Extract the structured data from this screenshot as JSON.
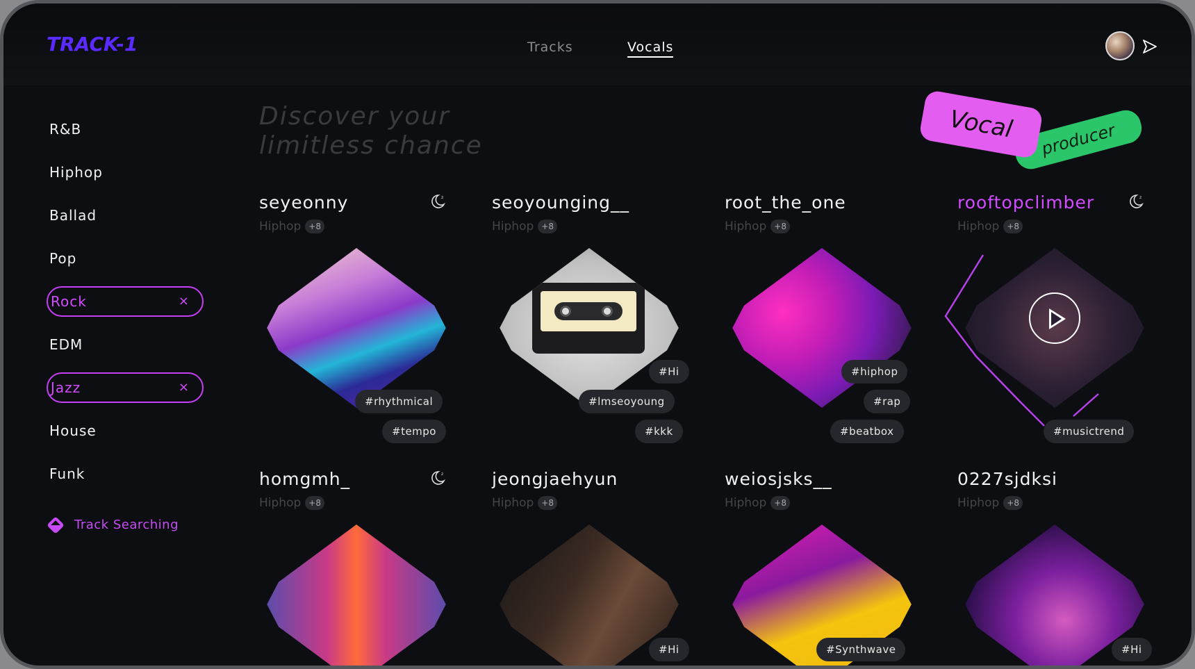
{
  "brand": {
    "logo_text": "TRACK-1",
    "accent": "#5a2bff"
  },
  "nav": {
    "tracks": "Tracks",
    "vocals": "Vocals",
    "active": "Vocals"
  },
  "sidebar": {
    "genres": [
      {
        "label": "R&B",
        "selected": false
      },
      {
        "label": "Hiphop",
        "selected": false
      },
      {
        "label": "Ballad",
        "selected": false
      },
      {
        "label": "Pop",
        "selected": false
      },
      {
        "label": "Rock",
        "selected": true
      },
      {
        "label": "EDM",
        "selected": false
      },
      {
        "label": "Jazz",
        "selected": true
      },
      {
        "label": "House",
        "selected": false
      },
      {
        "label": "Funk",
        "selected": false
      }
    ],
    "remove_glyph": "×",
    "track_search": "Track Searching"
  },
  "hero": {
    "headline_line1": "Discover your",
    "headline_line2": "limitless chance",
    "sticker_vocal": "Vocal",
    "sticker_producer": "producer"
  },
  "cards": [
    {
      "name": "seyeonny",
      "genre": "Hiphop",
      "more": "+8",
      "tags": [
        "#rhythmical",
        "#tempo"
      ],
      "moon": true
    },
    {
      "name": "seoyounging__",
      "genre": "Hiphop",
      "more": "+8",
      "tags": [
        "#Hi",
        "#lmseoyoung",
        "#kkk"
      ],
      "moon": false
    },
    {
      "name": "root_the_one",
      "genre": "Hiphop",
      "more": "+8",
      "tags": [
        "#hiphop",
        "#rap",
        "#beatbox"
      ],
      "moon": false
    },
    {
      "name": "rooftopclimber",
      "genre": "Hiphop",
      "more": "+8",
      "tags": [
        "#musictrend"
      ],
      "moon": true
    },
    {
      "name": "homgmh_",
      "genre": "Hiphop",
      "more": "+8",
      "tags": [],
      "moon": true
    },
    {
      "name": "jeongjaehyun",
      "genre": "Hiphop",
      "more": "+8",
      "tags": [
        "#Hi"
      ],
      "moon": false
    },
    {
      "name": "weiosjsks__",
      "genre": "Hiphop",
      "more": "+8",
      "tags": [
        "#Synthwave"
      ],
      "moon": false
    },
    {
      "name": "0227sjdksi",
      "genre": "Hiphop",
      "more": "+8",
      "tags": [
        "#Hi"
      ],
      "moon": false
    }
  ],
  "colors": {
    "highlight": "#d24bff",
    "vocal_sticker": "#e35ef0",
    "producer_sticker": "#2cc66a"
  },
  "icons": {
    "moon": "moon-zzz-icon",
    "send": "send-icon",
    "play": "play-icon",
    "search": "diamond-search-icon"
  }
}
